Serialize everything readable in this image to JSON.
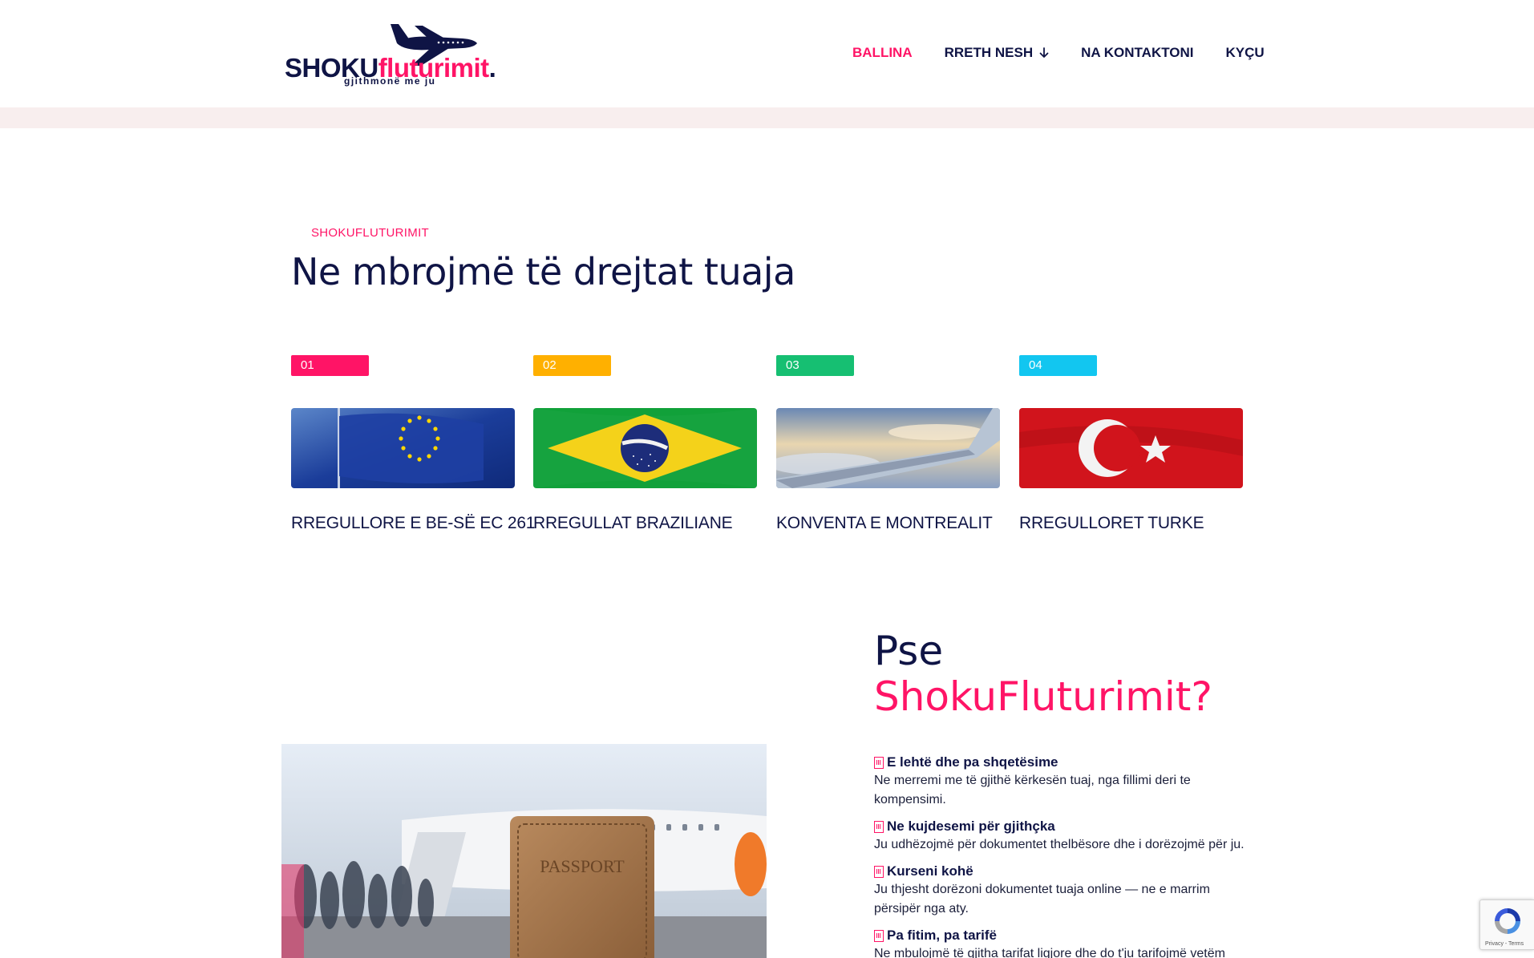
{
  "logo": {
    "part1": "SHOKU",
    "part2": "fluturimit",
    "part3": ".",
    "tagline": "gjithmonë me ju"
  },
  "nav": {
    "items": [
      "BALLINA",
      "RRETH NESH",
      "NA KONTAKTONI",
      "KYÇU"
    ],
    "active": "BALLINA"
  },
  "section_rights": {
    "eyebrow": "SHOKUFLUTURIMIT",
    "title": "Ne mbrojmë të drejtat tuaja",
    "cards": [
      {
        "number": "01",
        "color": "#ff1466",
        "title": "RREGULLORE E BE-së EC 261",
        "image": "eu-flag"
      },
      {
        "number": "02",
        "color": "#ffb000",
        "title": "RREGULLAT BRAZILIANE",
        "image": "brazil-flag"
      },
      {
        "number": "03",
        "color": "#16bf72",
        "title": "KONVENTA E MONTREALIT",
        "image": "airplane-wing"
      },
      {
        "number": "04",
        "color": "#12c6f0",
        "title": "RREGULLORET TURKE",
        "image": "turkey-flag"
      }
    ]
  },
  "section_why": {
    "title_line1": "Pse",
    "title_line2": "ShokuFluturimit?",
    "features": [
      {
        "title": "E lehtë dhe pa shqetësime",
        "desc": "Ne merremi me të gjithë kërkesën tuaj, nga fillimi deri te kompensimi."
      },
      {
        "title": "Ne kujdesemi për gjithçka",
        "desc": "Ju udhëzojmë për dokumentet thelbësore dhe i dorëzojmë për ju."
      },
      {
        "title": "Kurseni kohë",
        "desc": "Ju thjesht dorëzoni dokumentet tuaja online — ne e marrim përsipër nga aty."
      },
      {
        "title": "Pa fitim, pa tarifë",
        "desc": "Ne mbulojmë të gjitha tarifat ligjore dhe do t'ju tarifojmë vetëm"
      }
    ],
    "photo_text": "PASSPORT"
  },
  "recaptcha": {
    "text": "Privacy - Terms"
  },
  "colors": {
    "navy": "#0f1445",
    "pink": "#ff1466",
    "strip": "#f8eeee"
  }
}
